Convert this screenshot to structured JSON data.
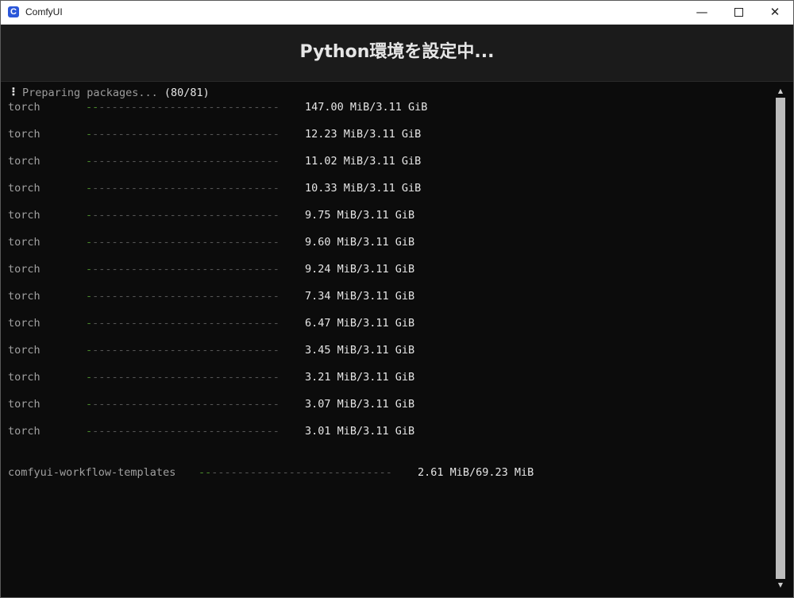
{
  "window": {
    "title": "ComfyUI",
    "icon_letter": "C",
    "minimize_glyph": "—",
    "close_glyph": "✕"
  },
  "header": {
    "title": "Python環境を設定中..."
  },
  "terminal": {
    "status_spinner": "⠸",
    "status_text": "Preparing packages...",
    "status_count": "(80/81)",
    "downloads": [
      {
        "package": "torch",
        "progress": 0.05,
        "size": "147.00 MiB/3.11 GiB"
      },
      {
        "package": "torch",
        "progress": 0.0,
        "size": "12.23 MiB/3.11 GiB"
      },
      {
        "package": "torch",
        "progress": 0.0,
        "size": "11.02 MiB/3.11 GiB"
      },
      {
        "package": "torch",
        "progress": 0.0,
        "size": "10.33 MiB/3.11 GiB"
      },
      {
        "package": "torch",
        "progress": 0.0,
        "size": "9.75 MiB/3.11 GiB"
      },
      {
        "package": "torch",
        "progress": 0.0,
        "size": "9.60 MiB/3.11 GiB"
      },
      {
        "package": "torch",
        "progress": 0.0,
        "size": "9.24 MiB/3.11 GiB"
      },
      {
        "package": "torch",
        "progress": 0.0,
        "size": "7.34 MiB/3.11 GiB"
      },
      {
        "package": "torch",
        "progress": 0.0,
        "size": "6.47 MiB/3.11 GiB"
      },
      {
        "package": "torch",
        "progress": 0.0,
        "size": "3.45 MiB/3.11 GiB"
      },
      {
        "package": "torch",
        "progress": 0.0,
        "size": "3.21 MiB/3.11 GiB"
      },
      {
        "package": "torch",
        "progress": 0.0,
        "size": "3.07 MiB/3.11 GiB"
      },
      {
        "package": "torch",
        "progress": 0.0,
        "size": "3.01 MiB/3.11 GiB"
      },
      {
        "package": "comfyui-workflow-templates",
        "progress": 0.04,
        "size": "2.61 MiB/69.23 MiB"
      }
    ]
  },
  "colors": {
    "bar_done": "#4a8a2a",
    "bar_rest": "#555555",
    "header_bg": "#1b1b1b",
    "terminal_bg": "#0c0c0c"
  }
}
